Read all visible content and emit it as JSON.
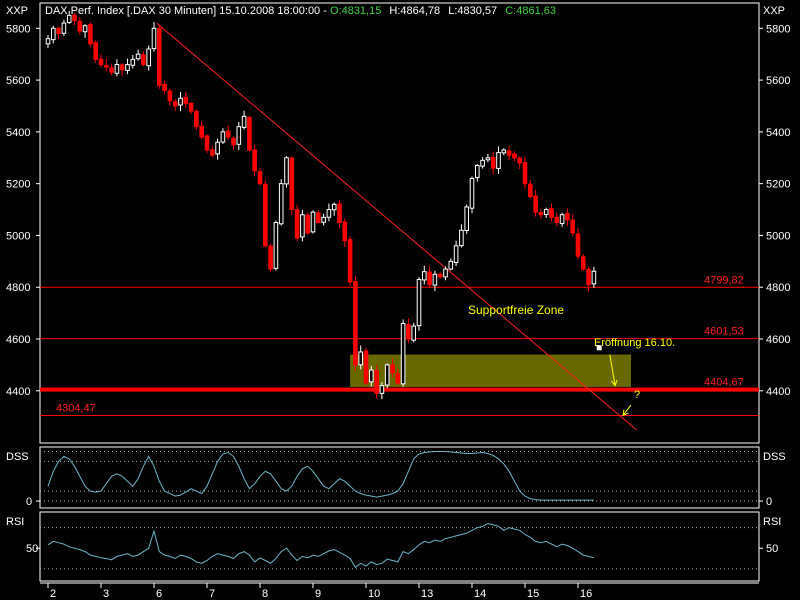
{
  "header": {
    "title": "DAX Perf. Index [.DAX  30 Minuten] 15.10.2008 18:00:00 -",
    "open": "O:4831,15",
    "high": "H:4864,78",
    "low": "L:4830,57",
    "close": "C:4861,63"
  },
  "axis_label_left": "XXP",
  "axis_label_right": "XXP",
  "colors": {
    "background": "#000000",
    "up_candle": "#ffffff",
    "down_candle": "#ff0000",
    "level_line": "#ff0000",
    "trend_line": "#ff2020",
    "zone_fill": "#7a7a00",
    "annotation_text": "#ffff00",
    "level_label": "#ff2020",
    "indicator_line": "#6fb4c8",
    "indicator_grid": "#aaaaaa"
  },
  "annotations": {
    "zone_label": "Supportfreie Zone",
    "opening_label": "Eröffnung 16.10.",
    "question_mark": "?"
  },
  "chart_data": [
    {
      "type": "candlestick",
      "title": "DAX Perf. Index [.DAX  30 Minuten] 15.10.2008 18:00:00",
      "y_ticks": [
        4400,
        4600,
        4800,
        5000,
        5200,
        5400,
        5600,
        5800
      ],
      "ylim": [
        4210,
        5890
      ],
      "x_tick_labels": [
        "2",
        "3",
        "6",
        "7",
        "8",
        "9",
        "10",
        "13",
        "14",
        "15",
        "16"
      ],
      "x_tick_index": [
        0,
        10,
        20,
        30,
        40,
        50,
        60,
        70,
        80,
        90,
        100
      ],
      "horizontal_levels": [
        {
          "value": 4799.82,
          "label": "4799,82",
          "label_pos": "right"
        },
        {
          "value": 4601.53,
          "label": "4601,53",
          "label_pos": "right"
        },
        {
          "value": 4404.67,
          "label": "4404,67",
          "label_pos": "right",
          "bold": true
        },
        {
          "value": 4304.47,
          "label": "4304,47",
          "label_pos": "left"
        }
      ],
      "trend_line": {
        "from": {
          "index": 20.5,
          "value": 5820
        },
        "to": {
          "index": 111,
          "value": 4250
        }
      },
      "zone": {
        "from_index": 57,
        "to_index": 110,
        "low": 4415,
        "high": 4540
      },
      "opening_marker": {
        "index": 104,
        "value": 4566
      },
      "arrow_to_opening": {
        "from": {
          "index": 106,
          "value": 4540
        },
        "to": {
          "index": 107,
          "value": 4420
        }
      },
      "question_arrow": {
        "from": {
          "index": 110,
          "value": 4345
        },
        "to": {
          "index": 108.5,
          "value": 4305
        }
      },
      "closes": [
        5760,
        5800,
        5780,
        5820,
        5850,
        5830,
        5790,
        5810,
        5740,
        5680,
        5660,
        5650,
        5630,
        5660,
        5640,
        5660,
        5680,
        5700,
        5660,
        5720,
        5800,
        5580,
        5560,
        5520,
        5500,
        5530,
        5510,
        5480,
        5420,
        5380,
        5330,
        5310,
        5360,
        5400,
        5380,
        5350,
        5420,
        5460,
        5330,
        5250,
        5200,
        4960,
        4870,
        5050,
        5200,
        5300,
        5100,
        4990,
        5080,
        5010,
        5090,
        5050,
        5070,
        5100,
        5120,
        5050,
        4980,
        4820,
        4500,
        4550,
        4430,
        4480,
        4390,
        4420,
        4500,
        4470,
        4430,
        4660,
        4600,
        4650,
        4830,
        4860,
        4810,
        4850,
        4840,
        4870,
        4900,
        4960,
        5020,
        5110,
        5220,
        5270,
        5290,
        5300,
        5260,
        5320,
        5330,
        5310,
        5300,
        5280,
        5200,
        5150,
        5090,
        5080,
        5100,
        5070,
        5050,
        5080,
        5060,
        5010,
        4920,
        4870,
        4810,
        4861.63
      ]
    },
    {
      "type": "line",
      "name": "DSS",
      "reference_values": [
        0,
        20,
        80,
        100
      ],
      "y_tick_labels": [
        "0"
      ],
      "ylim": [
        -10,
        105
      ],
      "values": [
        30,
        60,
        80,
        90,
        85,
        70,
        50,
        30,
        20,
        18,
        20,
        35,
        50,
        55,
        50,
        40,
        30,
        45,
        70,
        90,
        70,
        40,
        20,
        15,
        10,
        12,
        18,
        25,
        20,
        15,
        30,
        55,
        80,
        95,
        98,
        90,
        70,
        45,
        25,
        35,
        50,
        60,
        55,
        40,
        25,
        20,
        30,
        50,
        65,
        70,
        60,
        45,
        30,
        25,
        35,
        45,
        40,
        30,
        20,
        15,
        12,
        10,
        8,
        10,
        12,
        15,
        20,
        35,
        60,
        85,
        95,
        98,
        99,
        100,
        100,
        100,
        99,
        98,
        97,
        96,
        96,
        97,
        98,
        96,
        92,
        85,
        75,
        60,
        40,
        20,
        10,
        5,
        3,
        2,
        2,
        2,
        2,
        2,
        2,
        2,
        2,
        2,
        2,
        2
      ]
    },
    {
      "type": "line",
      "name": "RSI",
      "reference_values": [
        20,
        80
      ],
      "y_tick_labels": [
        "50"
      ],
      "ylim": [
        5,
        100
      ],
      "values": [
        55,
        60,
        58,
        56,
        52,
        50,
        48,
        45,
        40,
        38,
        36,
        35,
        33,
        38,
        40,
        42,
        38,
        40,
        45,
        50,
        75,
        45,
        40,
        38,
        35,
        40,
        38,
        35,
        30,
        28,
        32,
        38,
        42,
        40,
        38,
        35,
        42,
        45,
        40,
        30,
        36,
        32,
        28,
        35,
        45,
        50,
        40,
        32,
        38,
        36,
        40,
        38,
        42,
        46,
        48,
        44,
        40,
        35,
        22,
        28,
        24,
        30,
        26,
        28,
        34,
        32,
        30,
        45,
        42,
        48,
        55,
        60,
        58,
        62,
        60,
        64,
        66,
        68,
        70,
        72,
        76,
        80,
        82,
        86,
        84,
        82,
        76,
        80,
        78,
        76,
        70,
        66,
        60,
        58,
        60,
        56,
        52,
        56,
        54,
        50,
        45,
        40,
        38,
        36
      ]
    }
  ]
}
